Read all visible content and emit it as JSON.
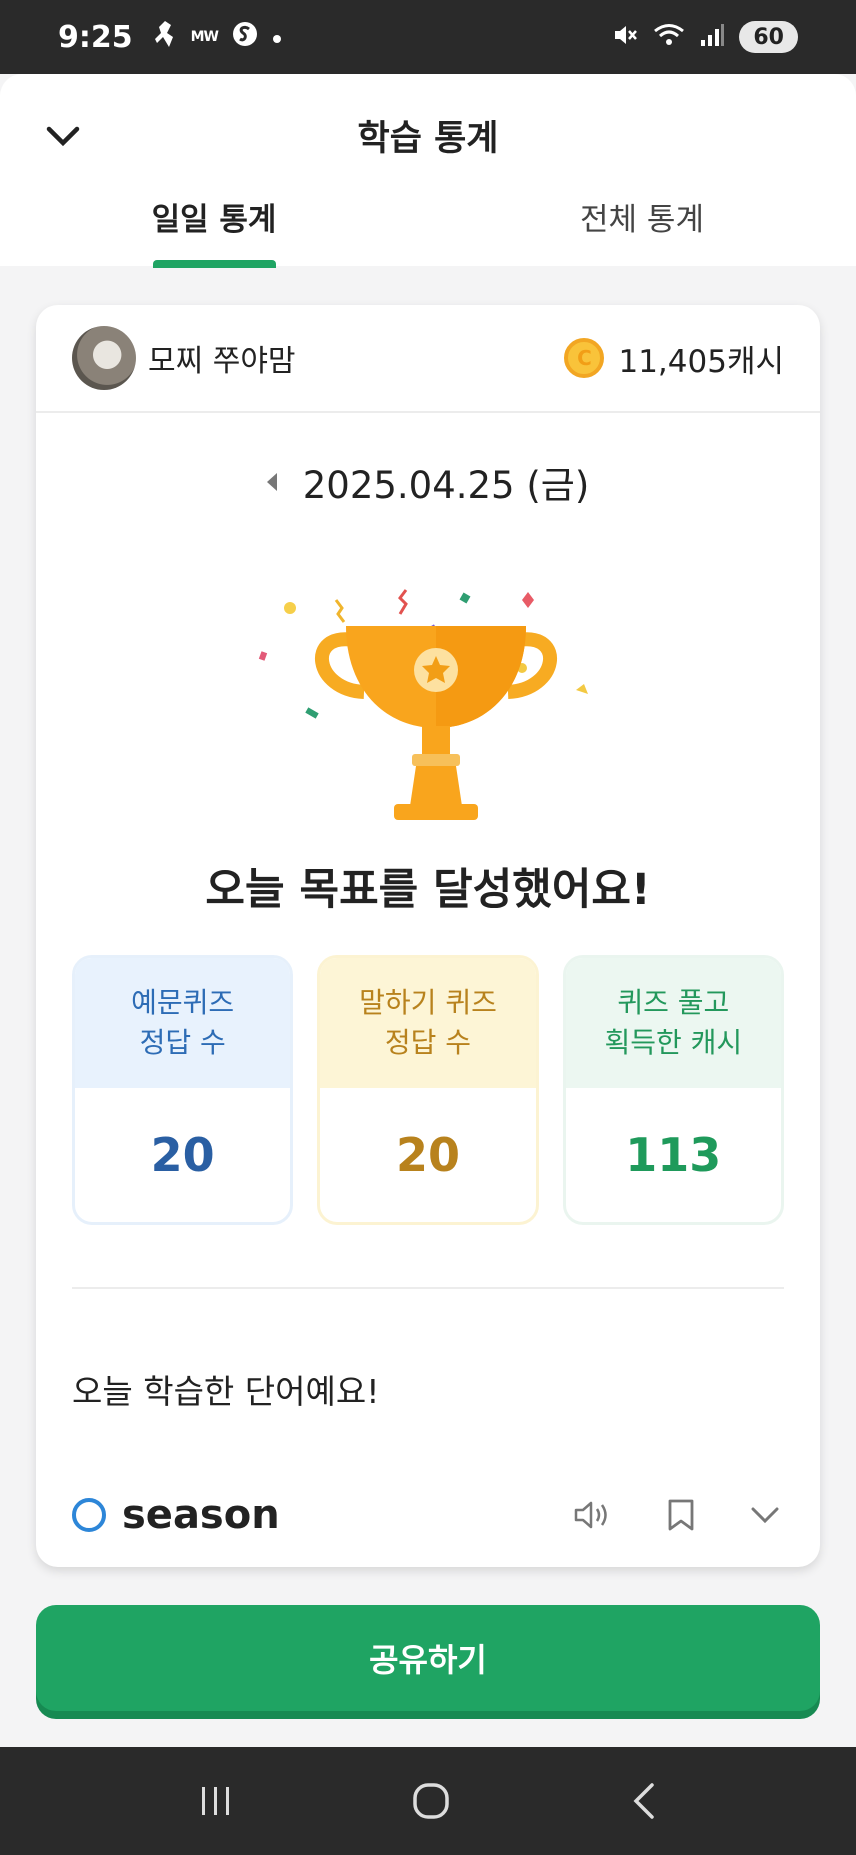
{
  "status_bar": {
    "time": "9:25",
    "left_icons": [
      "runner-icon",
      "mw-icon",
      "s-icon",
      "dot-icon"
    ],
    "right_icons": [
      "mute-icon",
      "wifi-icon",
      "signal-icon"
    ],
    "battery": "60"
  },
  "header": {
    "title": "학습 통계",
    "tabs": [
      {
        "label": "일일 통계",
        "active": true
      },
      {
        "label": "전체 통계",
        "active": false
      }
    ],
    "accent_color": "#1fa463"
  },
  "profile": {
    "name": "모찌 쭈야맘",
    "cash": "11,405캐시"
  },
  "date": "2025.04.25 (금)",
  "goal_message": "오늘 목표를 달성했어요!",
  "stats": [
    {
      "label_line1": "예문퀴즈",
      "label_line2": "정답 수",
      "value": "20",
      "color": "#2a5fa3"
    },
    {
      "label_line1": "말하기 퀴즈",
      "label_line2": "정답 수",
      "value": "20",
      "color": "#b8821d"
    },
    {
      "label_line1": "퀴즈 풀고",
      "label_line2": "획득한 캐시",
      "value": "113",
      "color": "#1f9a5b"
    }
  ],
  "words_section": {
    "title": "오늘 학습한 단어예요!",
    "words": [
      {
        "word": "season",
        "icons": [
          "speaker-icon",
          "bookmark-icon",
          "chevron-down-icon"
        ]
      }
    ]
  },
  "share_button": "공유하기",
  "nav_bar": [
    "recent-apps-icon",
    "home-icon",
    "back-icon"
  ]
}
